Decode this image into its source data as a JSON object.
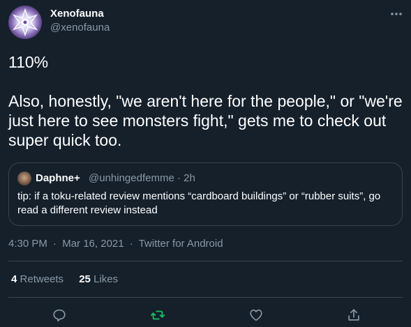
{
  "author": {
    "display_name": "Xenofauna",
    "handle": "@xenofauna"
  },
  "tweet": {
    "line1": "110%",
    "line2": "Also, honestly, \"we aren't here for the people,\" or \"we're just here to see monsters fight,\" gets me to check out super quick too."
  },
  "quote": {
    "display_name": "Daphne+",
    "handle": "@unhingedfemme · 2h",
    "text": "tip: if a toku-related review mentions “cardboard buildings” or “rubber suits”, go read a different review instead"
  },
  "meta": {
    "time": "4:30 PM",
    "date": "Mar 16, 2021",
    "source": "Twitter for Android",
    "separator": "·"
  },
  "stats": {
    "retweets_count": "4",
    "retweets_label": "Retweets",
    "likes_count": "25",
    "likes_label": "Likes"
  },
  "icons": {
    "reply": "reply-icon",
    "retweet": "retweet-icon",
    "like": "like-icon",
    "share": "share-icon",
    "more": "more-icon"
  },
  "colors": {
    "background": "#15202b",
    "text": "#ffffff",
    "secondary": "#8899a6",
    "border": "#38444d",
    "retweet_active": "#17bf63"
  }
}
